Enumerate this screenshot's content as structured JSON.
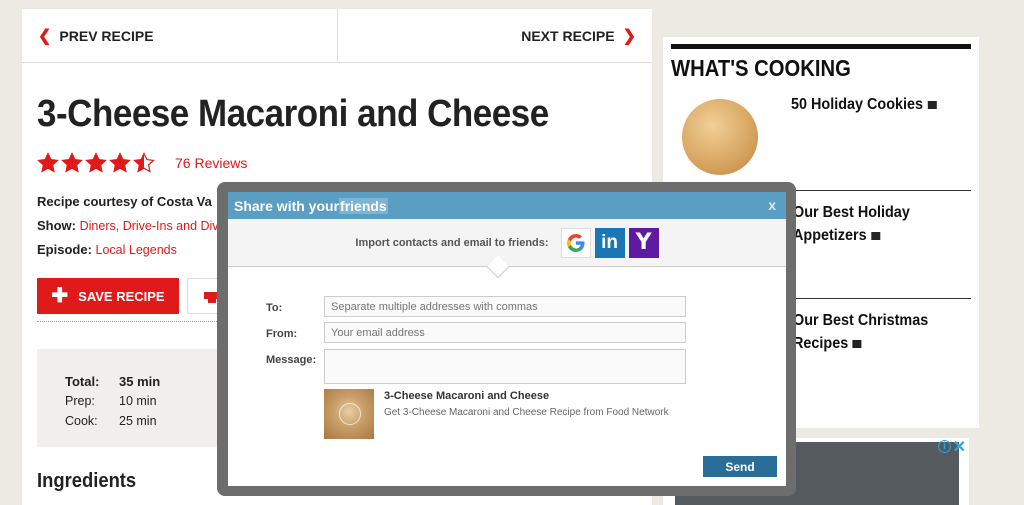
{
  "nav": {
    "prev_label": "PREV RECIPE",
    "next_label": "NEXT RECIPE"
  },
  "recipe": {
    "title": "3-Cheese Macaroni and Cheese",
    "rating": 4.5,
    "reviews_label": "76 Reviews",
    "courtesy": "Recipe courtesy of Costa Va",
    "show_label": "Show:",
    "show_value": "Diners, Drive-Ins and Div",
    "episode_label": "Episode:",
    "episode_value": "Local Legends",
    "save_label": "SAVE RECIPE",
    "times": [
      {
        "label": "Total:",
        "value": "35 min"
      },
      {
        "label": "Prep:",
        "value": "10 min"
      },
      {
        "label": "Cook:",
        "value": "25 min"
      }
    ],
    "ingredients_heading": "Ingredients"
  },
  "sidebar": {
    "heading": "WHAT'S COOKING",
    "items": [
      {
        "line1": "50 Holiday Cookies",
        "line2": ""
      },
      {
        "line1": "Our Best Holiday",
        "line2": "Appetizers"
      },
      {
        "line1": "Our Best Christmas",
        "line2": "Recipes"
      }
    ]
  },
  "modal": {
    "title_pre": "Share with your ",
    "title_hl": "friends",
    "close": "x",
    "import_label": "Import contacts and email to friends:",
    "services": [
      "google-icon",
      "linkedin-icon",
      "yahoo-icon"
    ],
    "to_label": "To:",
    "to_placeholder": "Separate multiple addresses with commas",
    "from_label": "From:",
    "from_placeholder": "Your email address",
    "message_label": "Message:",
    "preview_title": "3-Cheese Macaroni and Cheese",
    "preview_desc": "Get 3-Cheese Macaroni and Cheese Recipe from Food Network",
    "send_label": "Send"
  },
  "colors": {
    "brand_red": "#e0191a",
    "modal_header": "#5b9ec3",
    "send_blue": "#2a6d96"
  }
}
